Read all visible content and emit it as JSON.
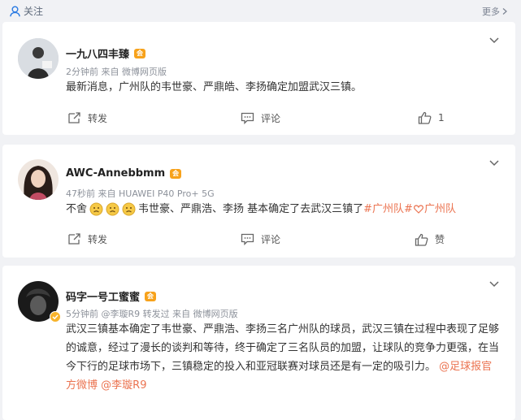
{
  "topbar": {
    "follow_label": "关注",
    "more_label": "更多"
  },
  "posts": [
    {
      "name": "一九八四丰臻",
      "meta": "2分钟前  来自 微博网页版",
      "content": "最新消息，广州队的韦世豪、严鼎皓、李扬确定加盟武汉三镇。",
      "repost_label": "转发",
      "comment_label": "评论",
      "like_label": "1"
    },
    {
      "name": "AWC-Annebbmm",
      "meta": "47秒前  来自 HUAWEI P40 Pro+ 5G",
      "content_prefix": "不舍",
      "content_main": "韦世豪、严鼎浩、李扬 基本确定了去武汉三镇了",
      "hashtag1": "#广州队#",
      "hashtag2": "广州队",
      "repost_label": "转发",
      "comment_label": "评论",
      "like_label": "赞"
    },
    {
      "name": "码字一号工蜜蜜",
      "meta": "5分钟前 @李璇R9 转发过  来自 微博网页版",
      "content": "武汉三镇基本确定了韦世豪、严鼎浩、李扬三名广州队的球员，武汉三镇在过程中表现了足够的诚意，经过了漫长的谈判和等待，终于确定了三名队员的加盟，让球队的竞争力更强，在当今下行的足球市场下，三镇稳定的投入和亚冠联赛对球员还是有一定的吸引力。",
      "mention1": "@足球报官方微博",
      "mention2": "@李璇R9"
    }
  ]
}
